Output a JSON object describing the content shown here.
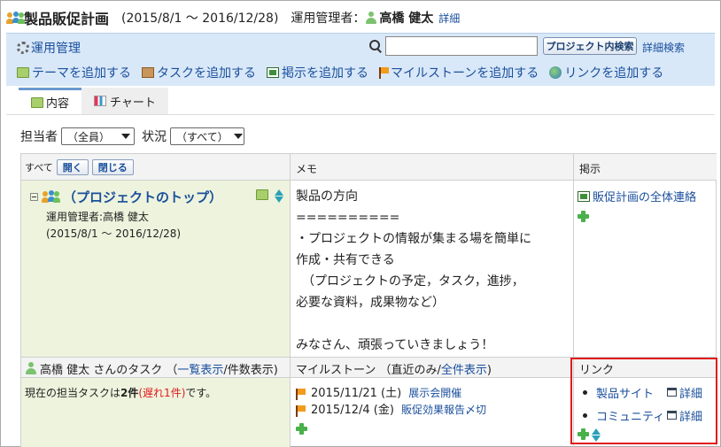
{
  "title": {
    "name": "製品販促計画",
    "period": "(2015/8/1 ～ 2016/12/28)",
    "manager_label": "運用管理者：",
    "manager_name": "高橋 健太",
    "detail_link": "詳細"
  },
  "toolbar": {
    "admin_link": "運用管理",
    "search_value": "",
    "search_button": "プロジェクト内検索",
    "advanced_search": "詳細検索",
    "actions": [
      {
        "label": "テーマを追加する",
        "icon": "folder-icon"
      },
      {
        "label": "タスクを追加する",
        "icon": "box-icon"
      },
      {
        "label": "掲示を追加する",
        "icon": "board-icon"
      },
      {
        "label": "マイルストーンを追加する",
        "icon": "flag-icon"
      },
      {
        "label": "リンクを追加する",
        "icon": "globe-icon"
      }
    ]
  },
  "tabs": [
    {
      "label": "内容",
      "active": true
    },
    {
      "label": "チャート",
      "active": false
    }
  ],
  "filters": {
    "assignee_label": "担当者",
    "assignee_value": "（全員）",
    "status_label": "状況",
    "status_value": "（すべて）"
  },
  "table": {
    "header": {
      "all_label": "すべて",
      "open_button": "開く",
      "close_button": "閉じる",
      "memo": "メモ",
      "board": "掲示"
    },
    "project": {
      "title": "（プロジェクトのトップ）",
      "manager": "運用管理者:高橋 健太",
      "period": "(2015/8/1 ～ 2016/12/28)"
    },
    "memo_text": "製品の方向\n==========\n・プロジェクトの情報が集まる場を簡単に\n作成・共有できる\n　（プロジェクトの予定，タスク，進捗，\n必要な資料，成果物など）\n\nみなさん、頑張っていきましょう！",
    "board_item": "販促計画の全体連絡",
    "tasks": {
      "header_prefix": "高橋 健太 さんのタスク （",
      "list_view": "一覧表示",
      "count_view": "/件数表示)",
      "summary_before": "現在の担当タスクは",
      "summary_count": "2件",
      "summary_late": "(遅れ1件)",
      "summary_after": "です。"
    },
    "milestones": {
      "header_prefix": "マイルストーン （直近のみ/",
      "show_all": "全件表示",
      "header_suffix": ")",
      "items": [
        {
          "date": "2015/11/21 (土)",
          "title": "展示会開催"
        },
        {
          "date": "2015/12/4 (金)",
          "title": "販促効果報告〆切"
        }
      ]
    },
    "links": {
      "header": "リンク",
      "items": [
        {
          "label": "製品サイト",
          "detail": "詳細"
        },
        {
          "label": "コミュニティ",
          "detail": "詳細"
        }
      ]
    }
  },
  "colors": {
    "link": "#1a4f9c",
    "toolbar_bg": "#d9e8f8",
    "project_bg": "#eef3dd",
    "late_red": "#e01a1a",
    "highlight_border": "#e01a1a"
  }
}
